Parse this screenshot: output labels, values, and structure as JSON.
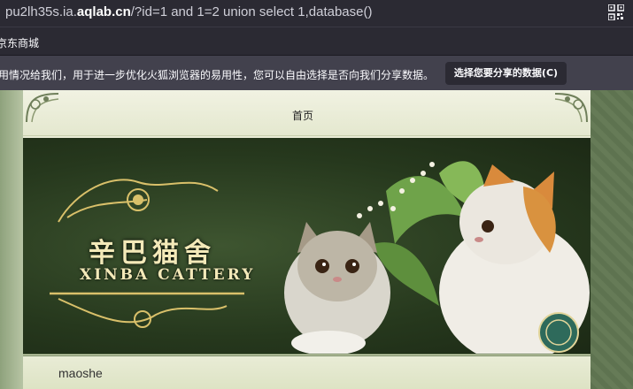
{
  "browser": {
    "url_prefix": "pu2lh35s.ia.",
    "url_domain": "aqlab.cn",
    "url_path": "/?id=1 and 1=2 union select 1,database()"
  },
  "bookmarks": {
    "items": [
      "京东商城"
    ]
  },
  "notification": {
    "message": "用情况给我们，用于进一步优化火狐浏览器的易用性，您可以自由选择是否向我们分享数据。",
    "button_label": "选择您要分享的数据(C)"
  },
  "site": {
    "nav_home": "首页",
    "banner_title_cn": "辛巴猫舍",
    "banner_title_en": "XINBA CATTERY",
    "footer_text": "maoshe"
  },
  "colors": {
    "browser_bg": "#2b2a33",
    "notif_bg": "#42414d",
    "page_green": "#7b8f6b",
    "banner_green": "#26381d",
    "gold": "#f3e9b8"
  },
  "icons": {
    "qr": "qr-code-icon"
  }
}
